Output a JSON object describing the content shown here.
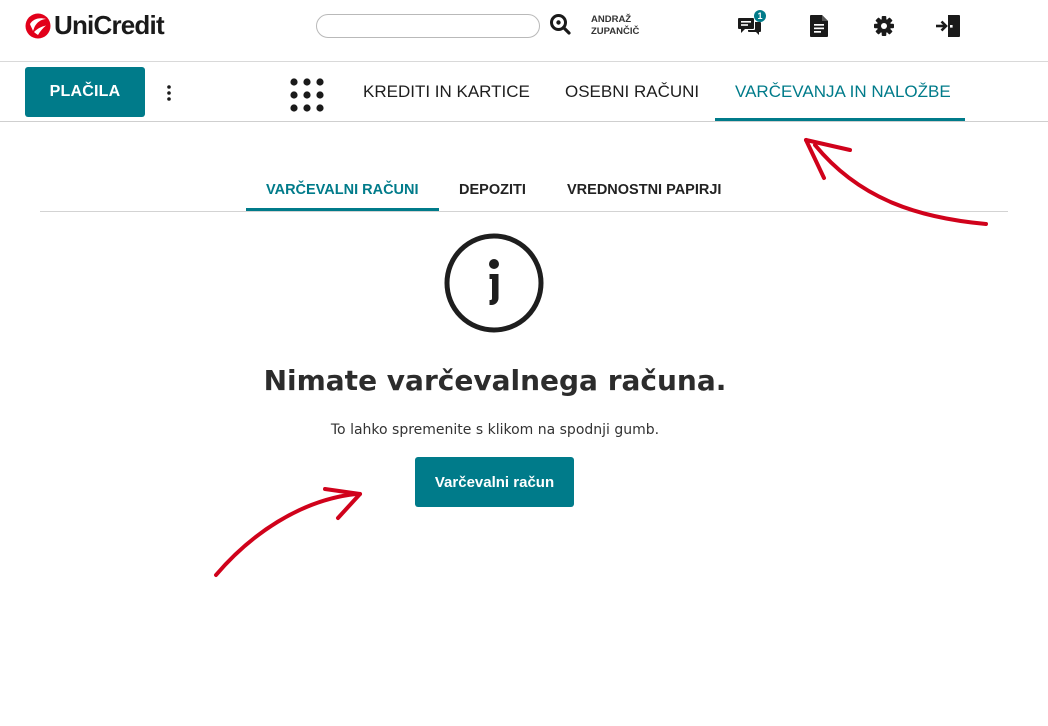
{
  "brand": {
    "name": "UniCredit",
    "accent": "#007b8a",
    "logo_red": "#e2001a"
  },
  "header": {
    "search": {
      "value": "",
      "placeholder": "",
      "icon": "search-icon"
    },
    "user": {
      "first_name": "ANDRAŽ",
      "last_name": "ZUPANČIČ"
    },
    "icons": [
      {
        "name": "messages-icon",
        "badge": "1"
      },
      {
        "name": "document-icon"
      },
      {
        "name": "settings-gear-icon"
      },
      {
        "name": "logout-icon"
      }
    ]
  },
  "nav": {
    "primary_button": "PLAČILA",
    "more_icon": "vertical-dots-icon",
    "apps_icon": "apps-grid-icon",
    "tabs": [
      {
        "label": "KREDITI IN KARTICE",
        "active": false
      },
      {
        "label": "OSEBNI RAČUNI",
        "active": false
      },
      {
        "label": "VARČEVANJA IN NALOŽBE",
        "active": true
      }
    ]
  },
  "subtabs": [
    {
      "label": "VARČEVALNI RAČUNI",
      "active": true
    },
    {
      "label": "DEPOZITI",
      "active": false
    },
    {
      "label": "VREDNOSTNI PAPIRJI",
      "active": false
    }
  ],
  "empty_state": {
    "icon": "info-icon",
    "title": "Nimate varčevalnega računa.",
    "text": "To lahko spremenite s klikom na spodnji gumb.",
    "button": "Varčevalni račun"
  },
  "annotation_color": "#d0021b"
}
